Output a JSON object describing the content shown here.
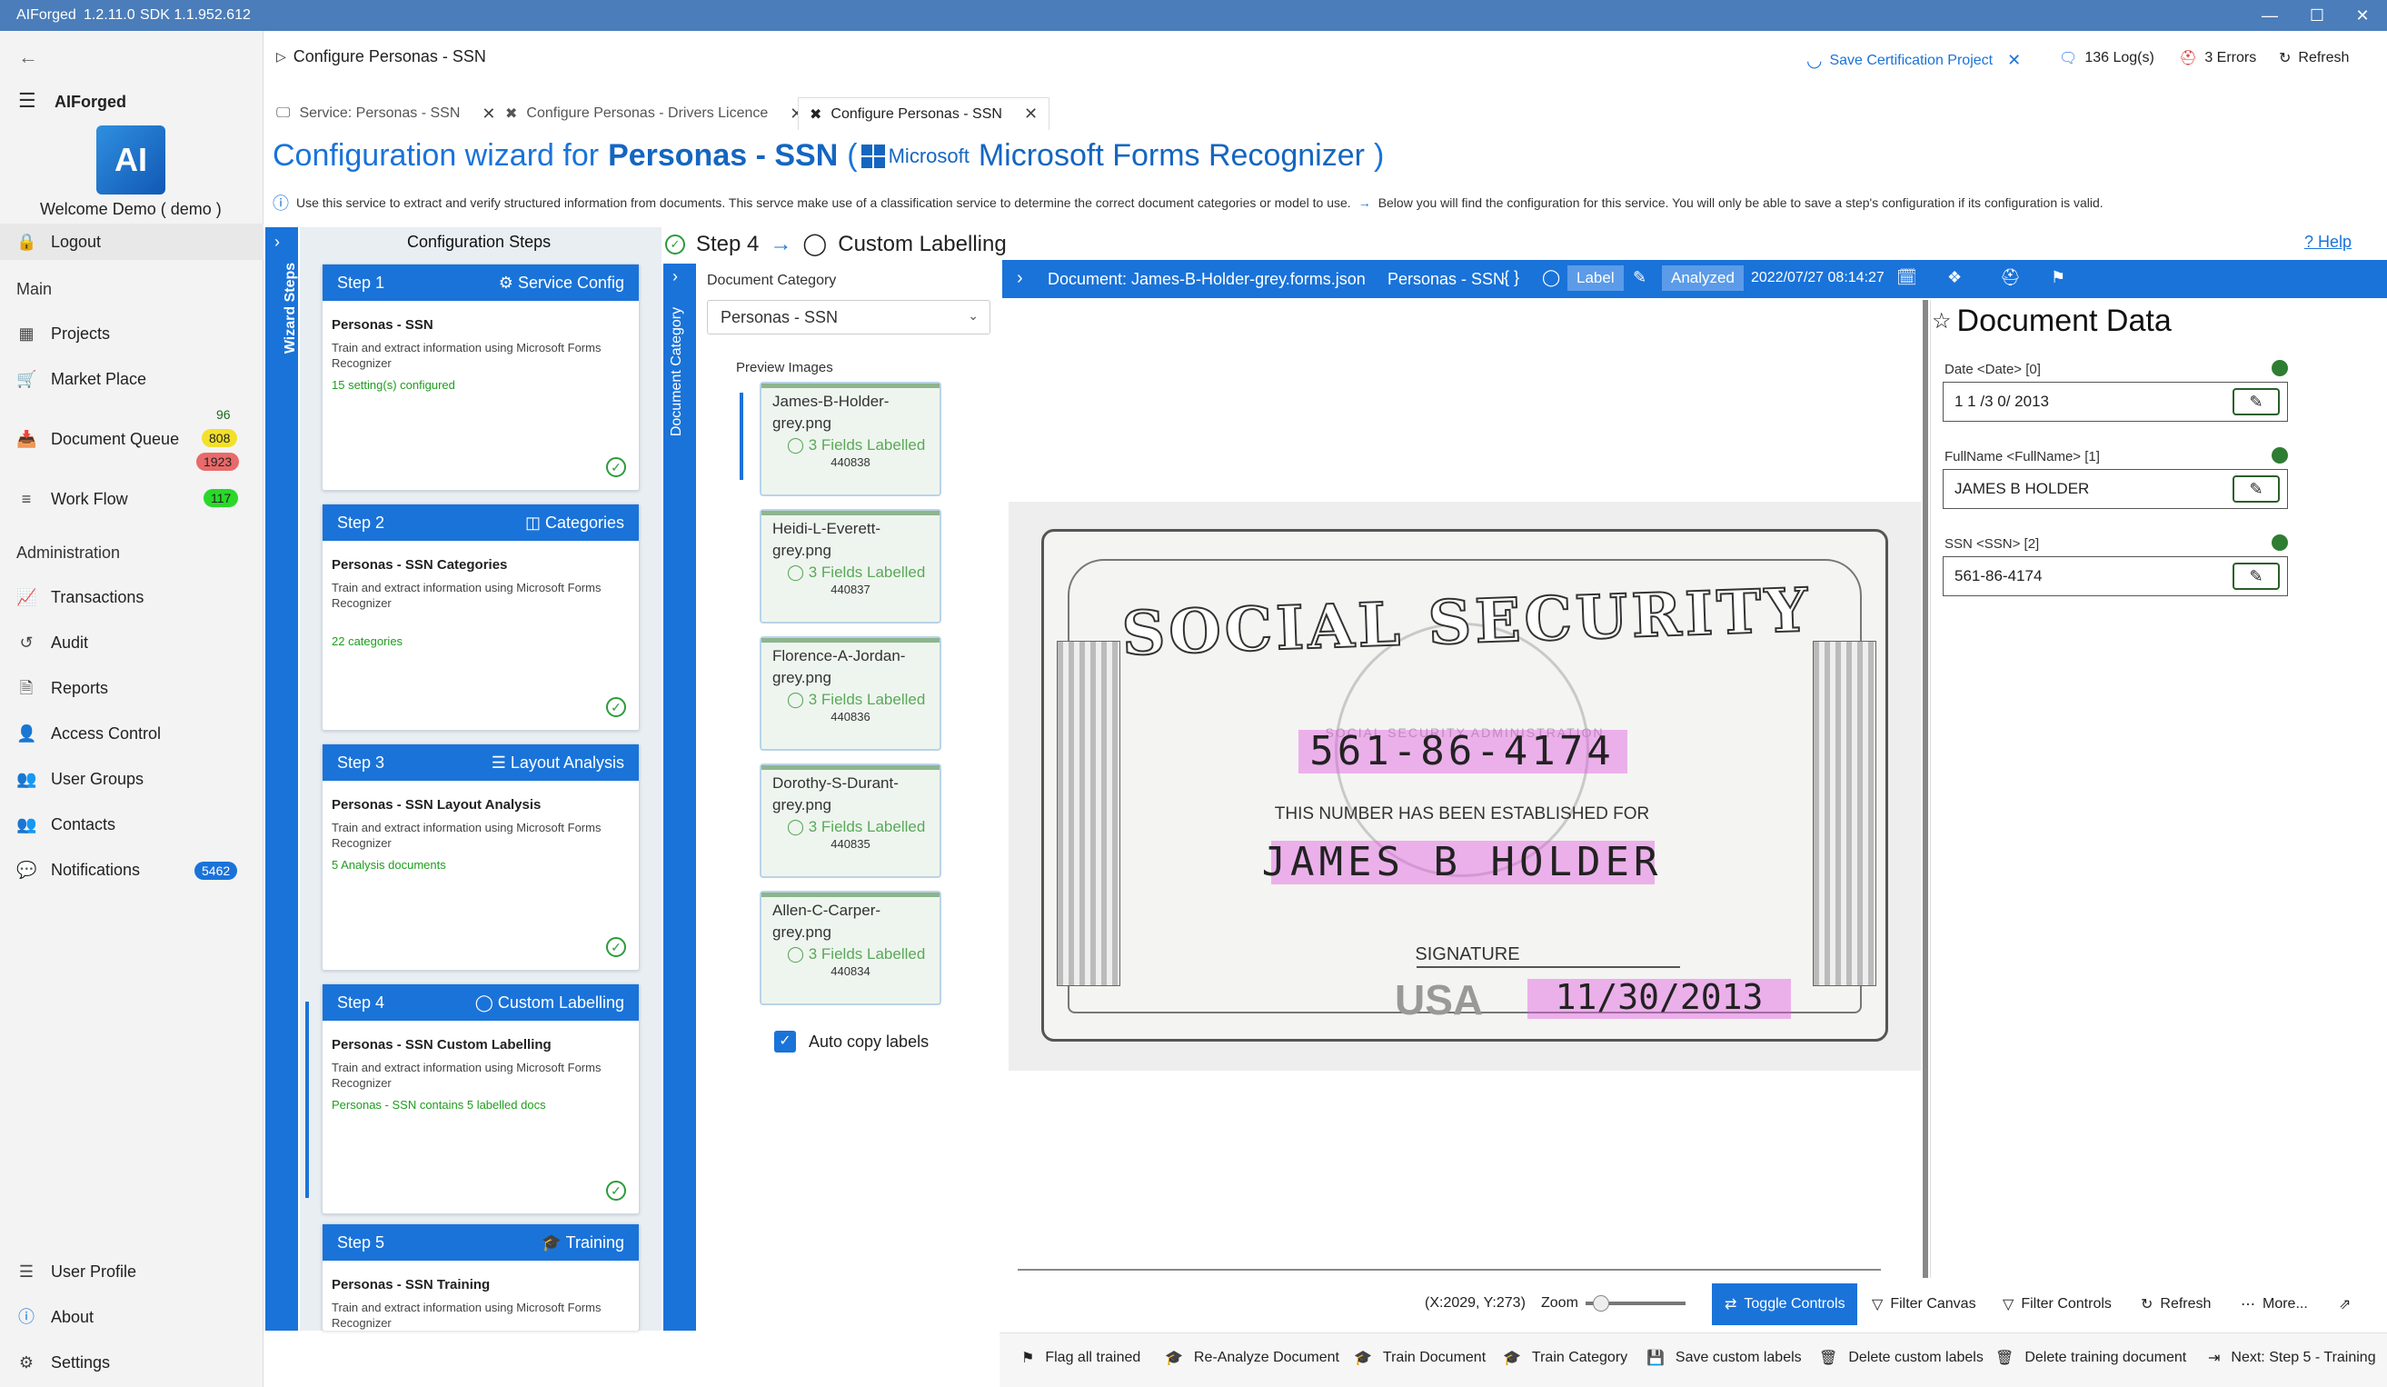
{
  "window": {
    "app": "AIForged",
    "version": "1.2.11.0",
    "sdk": "SDK 1.1.952.612"
  },
  "nav": {
    "brand": "AIForged",
    "welcome": "Welcome Demo ( demo )",
    "logout": "Logout",
    "main_header": "Main",
    "projects": "Projects",
    "market_place": "Market Place",
    "document_queue": "Document Queue",
    "dq_badge_a": "96",
    "dq_badge_b": "808",
    "dq_badge_c": "1923",
    "work_flow": "Work Flow",
    "wf_badge": "117",
    "admin_header": "Administration",
    "transactions": "Transactions",
    "audit": "Audit",
    "reports": "Reports",
    "access_control": "Access Control",
    "user_groups": "User Groups",
    "contacts": "Contacts",
    "notifications": "Notifications",
    "notif_badge": "5462",
    "user_profile": "User Profile",
    "about": "About",
    "settings": "Settings"
  },
  "header": {
    "breadcrumb": "Configure Personas - SSN",
    "save_cert": "Save Certification Project",
    "logs": "136 Log(s)",
    "errors": "3 Errors",
    "refresh": "Refresh"
  },
  "tabs": [
    {
      "label": "Service: Personas - SSN"
    },
    {
      "label": "Configure Personas - Drivers Licence"
    },
    {
      "label": "Configure Personas - SSN"
    }
  ],
  "wizard": {
    "title_prefix": "Configuration wizard for",
    "title_name": "Personas - SSN",
    "paren_open": "(",
    "ms_logo_text": "Microsoft",
    "recognizer": "Microsoft Forms Recognizer",
    "paren_close": ")",
    "info": "Use this service to extract and verify structured information from documents.  This servce make use of a classification service to determine the correct document categories or model to use.",
    "info2": "Below you will find the configuration for this service. You will only be able to save a step's configuration if its configuration is valid.",
    "side_label": "Wizard Steps",
    "config_steps": "Configuration Steps",
    "current_step": "Step 4",
    "current_step_name": "Custom Labelling",
    "help": "Help"
  },
  "steps": [
    {
      "num": "Step 1",
      "type": "Service Config",
      "title": "Personas - SSN",
      "desc": "Train and extract information using Microsoft Forms Recognizer",
      "status": "15 setting(s) configured"
    },
    {
      "num": "Step 2",
      "type": "Categories",
      "title": "Personas - SSN Categories",
      "desc": "Train and extract information using Microsoft Forms Recognizer",
      "status": "22 categories"
    },
    {
      "num": "Step 3",
      "type": "Layout Analysis",
      "title": "Personas - SSN Layout Analysis",
      "desc": "Train and extract information using Microsoft Forms Recognizer",
      "status": "5 Analysis documents"
    },
    {
      "num": "Step 4",
      "type": "Custom Labelling",
      "title": "Personas - SSN Custom Labelling",
      "desc": "Train and extract information using Microsoft Forms Recognizer",
      "status": "Personas - SSN contains 5 labelled docs"
    },
    {
      "num": "Step 5",
      "type": "Training",
      "title": "Personas - SSN Training",
      "desc": "Train and extract information using Microsoft Forms Recognizer",
      "status": ""
    }
  ],
  "category": {
    "side_label": "Document Category",
    "label": "Document Category",
    "selected": "Personas - SSN",
    "preview_label": "Preview Images",
    "auto_copy": "Auto copy labels"
  },
  "previews": [
    {
      "name": "James-B-Holder-grey.png",
      "fields": "3 Fields Labelled",
      "id": "440838"
    },
    {
      "name": "Heidi-L-Everett-grey.png",
      "fields": "3 Fields Labelled",
      "id": "440837"
    },
    {
      "name": "Florence-A-Jordan-grey.png",
      "fields": "3 Fields Labelled",
      "id": "440836"
    },
    {
      "name": "Dorothy-S-Durant-grey.png",
      "fields": "3 Fields Labelled",
      "id": "440835"
    },
    {
      "name": "Allen-C-Carper-grey.png",
      "fields": "3 Fields Labelled",
      "id": "440834"
    }
  ],
  "document": {
    "title": "Document: James-B-Holder-grey.forms.json",
    "service": "Personas - SSN",
    "label_tag": "Label",
    "analyzed_tag": "Analyzed",
    "timestamp": "2022/07/27 08:14:27"
  },
  "card": {
    "title": "SOCIAL SECURITY",
    "ssn": "561-86-4174",
    "established": "THIS NUMBER HAS BEEN ESTABLISHED FOR",
    "name": "JAMES B HOLDER",
    "signature": "SIGNATURE",
    "date": "11/30/2013",
    "usa": "USA",
    "seal_text": "SOCIAL SECURITY ADMINISTRATION"
  },
  "doc_data": {
    "title": "Document Data",
    "fields": [
      {
        "label": "Date <Date> [0]",
        "value": "1 1 /3 0/ 2013"
      },
      {
        "label": "FullName <FullName> [1]",
        "value": "JAMES B HOLDER"
      },
      {
        "label": "SSN <SSN> [2]",
        "value": "561-86-4174"
      }
    ]
  },
  "controls": {
    "coords": "(X:2029, Y:273)",
    "zoom": "Zoom",
    "toggle": "Toggle Controls",
    "filter_canvas": "Filter Canvas",
    "filter_controls": "Filter Controls",
    "refresh": "Refresh",
    "more": "More..."
  },
  "actions": {
    "flag": "Flag all trained",
    "reanalyze": "Re-Analyze Document",
    "train_doc": "Train Document",
    "train_cat": "Train Category",
    "save_labels": "Save custom labels",
    "delete_labels": "Delete custom labels",
    "delete_training": "Delete training document",
    "next": "Next: Step 5 - Training"
  },
  "colors": {
    "accent": "#1a73d9",
    "success": "#2a9d3a",
    "highlight": "#e05de0"
  }
}
